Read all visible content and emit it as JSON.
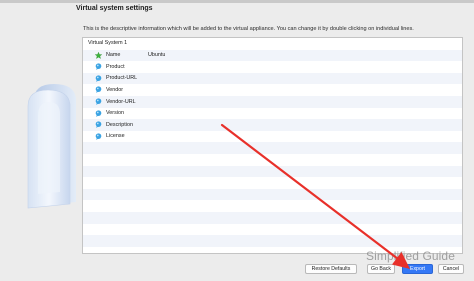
{
  "header": {
    "title": "Virtual system settings",
    "description": "This is the descriptive information which will be added to the virtual appliance. You can change it by double clicking on individual lines."
  },
  "system": {
    "label": "Virtual System 1",
    "properties": [
      {
        "label": "Name",
        "value": "Ubuntu",
        "icon": "green-star-icon"
      },
      {
        "label": "Product",
        "value": "",
        "icon": "speech-bubble-icon"
      },
      {
        "label": "Product-URL",
        "value": "",
        "icon": "speech-bubble-icon"
      },
      {
        "label": "Vendor",
        "value": "",
        "icon": "speech-bubble-icon"
      },
      {
        "label": "Vendor-URL",
        "value": "",
        "icon": "speech-bubble-icon"
      },
      {
        "label": "Version",
        "value": "",
        "icon": "speech-bubble-icon"
      },
      {
        "label": "Description",
        "value": "",
        "icon": "speech-bubble-icon"
      },
      {
        "label": "License",
        "value": "",
        "icon": "speech-bubble-icon"
      }
    ]
  },
  "buttons": {
    "restore_defaults": "Restore Defaults",
    "go_back": "Go Back",
    "export": "Export",
    "cancel": "Cancel"
  },
  "watermark": "Simplified Guide",
  "colors": {
    "accent": "#3478f6",
    "arrow": "#e8302a",
    "row_alt": "#f1f4fa",
    "star": "#3cb43c",
    "bubble": "#3aa3e3"
  }
}
